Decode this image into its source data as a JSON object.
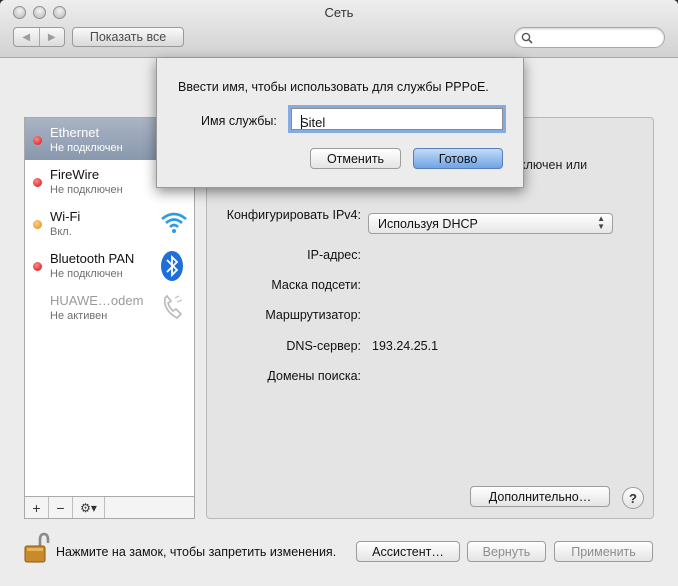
{
  "window": {
    "title": "Сеть"
  },
  "toolbar": {
    "show_all": "Показать все",
    "search_placeholder": ""
  },
  "services": [
    {
      "name": "Ethernet",
      "status": "Не подключен",
      "dot": "red",
      "selected": true,
      "icon": "ethernet-icon"
    },
    {
      "name": "FireWire",
      "status": "Не подключен",
      "dot": "red",
      "icon": "firewire-icon"
    },
    {
      "name": "Wi-Fi",
      "status": "Вкл.",
      "dot": "orange",
      "icon": "wifi-icon"
    },
    {
      "name": "Bluetooth PAN",
      "status": "Не подключен",
      "dot": "red",
      "icon": "bluetooth-icon"
    },
    {
      "name": "HUAWE…odem",
      "status": "Не активен",
      "dot": "none",
      "icon": "phone-icon"
    }
  ],
  "sidebar_controls": {
    "add": "+",
    "remove": "−",
    "action": "⚙▾"
  },
  "detail": {
    "status_fragment": "ключен или",
    "configure_label": "Конфигурировать IPv4:",
    "configure_value": "Используя DHCP",
    "ip_label": "IP-адрес:",
    "mask_label": "Маска подсети:",
    "router_label": "Маршрутизатор:",
    "dns_label": "DNS-сервер:",
    "dns_value": "193.24.25.1",
    "search_domains_label": "Домены поиска:",
    "advanced_button": "Дополнительно…",
    "help": "?"
  },
  "footer": {
    "lock_text": "Нажмите на замок, чтобы запретить изменения.",
    "assistant_button": "Ассистент…",
    "revert_button": "Вернуть",
    "apply_button": "Применить"
  },
  "sheet": {
    "prompt": "Ввести имя, чтобы использовать для службы PPPoE.",
    "field_label": "Имя службы:",
    "field_value": "Sitel",
    "cancel_button": "Отменить",
    "ok_button": "Готово"
  },
  "colors": {
    "selection": "#8a98ad",
    "status_red": "#d20f0f",
    "status_orange": "#e38a00",
    "focus_ring": "#6496dc"
  }
}
